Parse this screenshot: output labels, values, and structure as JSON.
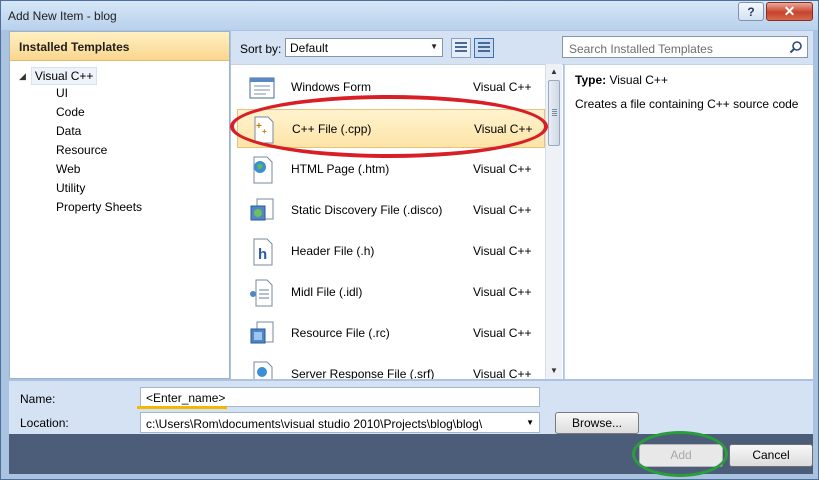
{
  "window": {
    "title": "Add New Item - blog",
    "help_label": "?",
    "close_label": "✕"
  },
  "left_panel": {
    "header": "Installed Templates",
    "root": "Visual C++",
    "children": [
      "UI",
      "Code",
      "Data",
      "Resource",
      "Web",
      "Utility",
      "Property Sheets"
    ]
  },
  "toolbar": {
    "sort_label": "Sort by:",
    "sort_value": "Default",
    "search_placeholder": "Search Installed Templates"
  },
  "templates": [
    {
      "name": "Windows Form",
      "type": "Visual C++",
      "icon": "form-icon"
    },
    {
      "name": "C++ File (.cpp)",
      "type": "Visual C++",
      "icon": "cpp-file-icon",
      "selected": true
    },
    {
      "name": "HTML Page (.htm)",
      "type": "Visual C++",
      "icon": "html-page-icon"
    },
    {
      "name": "Static Discovery File (.disco)",
      "type": "Visual C++",
      "icon": "disco-file-icon"
    },
    {
      "name": "Header File (.h)",
      "type": "Visual C++",
      "icon": "header-file-icon"
    },
    {
      "name": "Midl File (.idl)",
      "type": "Visual C++",
      "icon": "midl-file-icon"
    },
    {
      "name": "Resource File (.rc)",
      "type": "Visual C++",
      "icon": "resource-file-icon"
    },
    {
      "name": "Server Response File (.srf)",
      "type": "Visual C++",
      "icon": "srf-file-icon"
    }
  ],
  "description": {
    "type_label": "Type:",
    "type_value": "Visual C++",
    "text": "Creates a file containing C++ source code"
  },
  "fields": {
    "name_label": "Name:",
    "name_value": "<Enter_name>",
    "location_label": "Location:",
    "location_value": "c:\\Users\\Rom\\documents\\visual studio 2010\\Projects\\blog\\blog\\",
    "browse_label": "Browse..."
  },
  "buttons": {
    "add_label": "Add",
    "cancel_label": "Cancel"
  },
  "colors": {
    "selection": "#fde4a7",
    "annotation_red": "#d91f26",
    "annotation_green": "#2a9e3b",
    "annotation_orange": "#f5b800"
  }
}
